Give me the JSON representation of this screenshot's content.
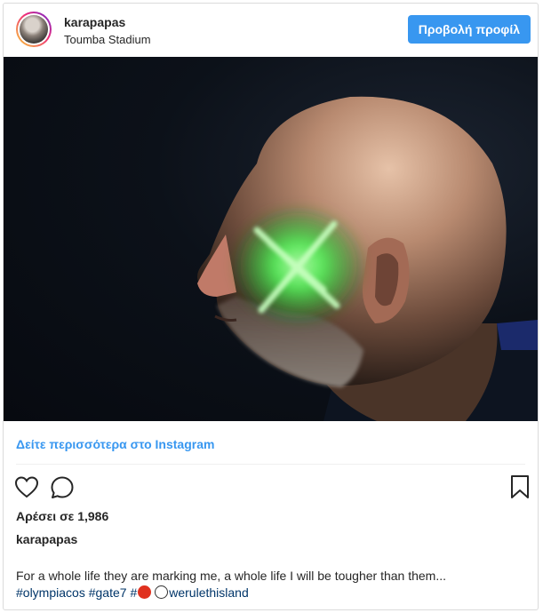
{
  "header": {
    "username": "karapapas",
    "location": "Toumba Stadium",
    "view_profile_label": "Προβολή προφίλ"
  },
  "photo": {
    "subject": "man-with-green-laser-on-face"
  },
  "links": {
    "see_more_label": "Δείτε περισσότερα στο Instagram"
  },
  "actions": {
    "like_icon": "heart-icon",
    "comment_icon": "comment-icon",
    "save_icon": "bookmark-icon"
  },
  "stats": {
    "likes_text": "Αρέσει σε 1,986"
  },
  "caption": {
    "username": "karapapas",
    "text": "For a whole life they are marking me, a whole life I will be tougher than them...",
    "tag1": "#olympiacos",
    "tag2": "#gate7",
    "tag3_prefix": "#",
    "tag3_suffix": "werulethisland",
    "emoji1": "red-circle-icon",
    "emoji2": "white-circle-icon"
  },
  "colors": {
    "accent": "#3897f0",
    "tag": "#003569",
    "text": "#262626",
    "laser": "#4dff5a"
  }
}
